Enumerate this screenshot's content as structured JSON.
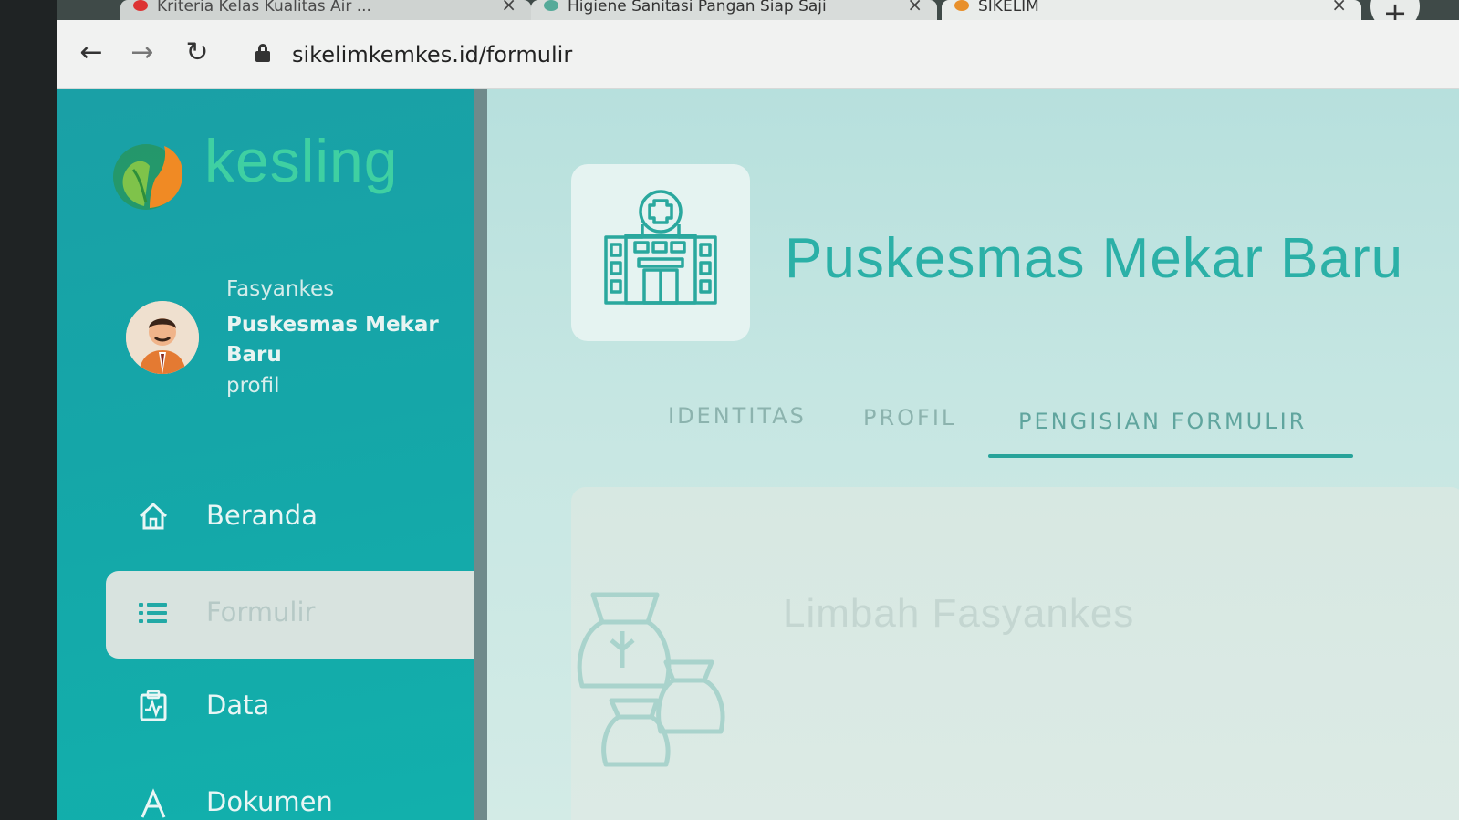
{
  "browser": {
    "tabs": [
      {
        "title": "Kriteria Kelas Kualitas Air ...",
        "active": false
      },
      {
        "title": "Higiene Sanitasi Pangan Siap Saji",
        "active": false
      },
      {
        "title": "SIKELIM",
        "active": true
      }
    ],
    "close_glyph": "×",
    "new_tab_glyph": "+",
    "url": "sikelimkemkes.id/formulir",
    "nav_glyphs": {
      "back": "←",
      "forward": "→",
      "reload": "↻"
    }
  },
  "sidebar": {
    "logo_text": "kesling",
    "user": {
      "role": "Fasyankes",
      "name": "Puskesmas Mekar Baru",
      "profile_link": "profil"
    },
    "nav": [
      {
        "label": "Beranda",
        "icon": "home-icon",
        "active": false
      },
      {
        "label": "Formulir",
        "icon": "list-icon",
        "active": true
      },
      {
        "label": "Data",
        "icon": "chart-icon",
        "active": false
      },
      {
        "label": "Dokumen",
        "icon": "document-icon",
        "active": false
      }
    ]
  },
  "main": {
    "facility_icon": "hospital-icon",
    "facility_name": "Puskesmas Mekar Baru",
    "tabs": [
      {
        "label": "IDENTITAS",
        "active": false
      },
      {
        "label": "PROFIL",
        "active": false
      },
      {
        "label": "PENGISIAN FORMULIR",
        "active": true
      }
    ],
    "form_section": {
      "title": "Limbah Fasyankes",
      "icon": "waste-bags-icon"
    }
  },
  "colors": {
    "sidebar": "#15a6a8",
    "accent": "#27a39a",
    "title": "#2bb0a7",
    "logo": "#3fd0a2"
  }
}
